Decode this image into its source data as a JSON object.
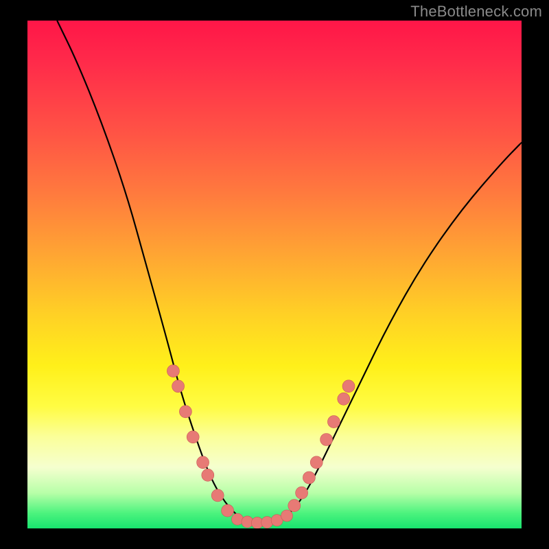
{
  "watermark": "TheBottleneck.com",
  "colors": {
    "frame": "#000000",
    "curve_stroke": "#000000",
    "marker_fill": "#e77a75",
    "marker_stroke": "#c85a55"
  },
  "chart_data": {
    "type": "line",
    "title": "",
    "xlabel": "",
    "ylabel": "",
    "xlim": [
      0,
      100
    ],
    "ylim": [
      0,
      100
    ],
    "grid": false,
    "legend": false,
    "curve_points": [
      {
        "x": 6,
        "y": 100
      },
      {
        "x": 10,
        "y": 92
      },
      {
        "x": 15,
        "y": 80
      },
      {
        "x": 20,
        "y": 66
      },
      {
        "x": 24,
        "y": 52
      },
      {
        "x": 28,
        "y": 38
      },
      {
        "x": 31,
        "y": 27
      },
      {
        "x": 34,
        "y": 18
      },
      {
        "x": 37,
        "y": 10
      },
      {
        "x": 40,
        "y": 5
      },
      {
        "x": 43,
        "y": 2
      },
      {
        "x": 46,
        "y": 1
      },
      {
        "x": 49,
        "y": 1
      },
      {
        "x": 52,
        "y": 2
      },
      {
        "x": 55,
        "y": 5
      },
      {
        "x": 58,
        "y": 10
      },
      {
        "x": 62,
        "y": 18
      },
      {
        "x": 67,
        "y": 28
      },
      {
        "x": 73,
        "y": 40
      },
      {
        "x": 80,
        "y": 52
      },
      {
        "x": 88,
        "y": 63
      },
      {
        "x": 96,
        "y": 72
      },
      {
        "x": 100,
        "y": 76
      }
    ],
    "markers_left": [
      {
        "x": 29.5,
        "y": 31
      },
      {
        "x": 30.5,
        "y": 28
      },
      {
        "x": 32.0,
        "y": 23
      },
      {
        "x": 33.5,
        "y": 18
      },
      {
        "x": 35.5,
        "y": 13
      },
      {
        "x": 36.5,
        "y": 10.5
      },
      {
        "x": 38.5,
        "y": 6.5
      },
      {
        "x": 40.5,
        "y": 3.5
      }
    ],
    "markers_bottom": [
      {
        "x": 42.5,
        "y": 1.8
      },
      {
        "x": 44.5,
        "y": 1.3
      },
      {
        "x": 46.5,
        "y": 1.1
      },
      {
        "x": 48.5,
        "y": 1.2
      },
      {
        "x": 50.5,
        "y": 1.6
      },
      {
        "x": 52.5,
        "y": 2.5
      }
    ],
    "markers_right": [
      {
        "x": 54.0,
        "y": 4.5
      },
      {
        "x": 55.5,
        "y": 7.0
      },
      {
        "x": 57.0,
        "y": 10.0
      },
      {
        "x": 58.5,
        "y": 13.0
      },
      {
        "x": 60.5,
        "y": 17.5
      },
      {
        "x": 62.0,
        "y": 21.0
      },
      {
        "x": 64.0,
        "y": 25.5
      },
      {
        "x": 65.0,
        "y": 28.0
      }
    ]
  }
}
